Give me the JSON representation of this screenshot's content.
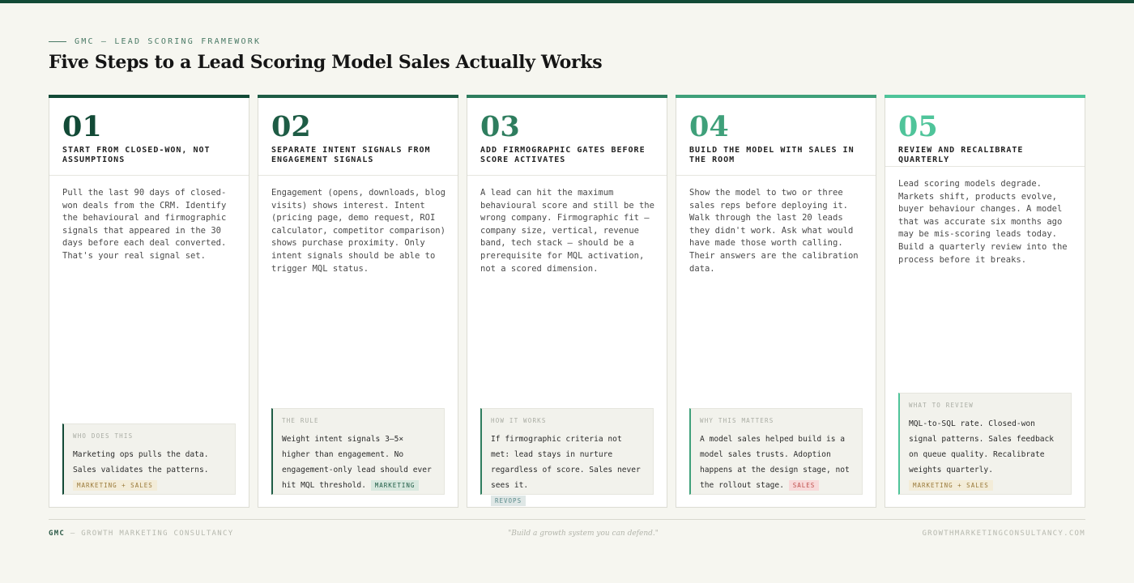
{
  "header": {
    "eyebrow": "GMC — LEAD SCORING FRAMEWORK",
    "title": "Five Steps to a Lead Scoring Model Sales Actually Works"
  },
  "colors": {
    "topbar": "#124a36",
    "step1": "#124a36",
    "step2": "#1e5c45",
    "step3": "#2e7d5e",
    "step4": "#3fa07a",
    "step5": "#4fc49a"
  },
  "steps": [
    {
      "number": "01",
      "title": "START FROM CLOSED-WON, NOT ASSUMPTIONS",
      "body": "Pull the last 90 days of closed-won deals from the CRM. Identify the behavioural and firmographic signals that appeared in the 30 days before each deal converted. That's your real signal set.",
      "note_label": "WHO DOES THIS",
      "note_text": "Marketing ops pulls the data. Sales validates the patterns.",
      "tag": "MARKETING + SALES"
    },
    {
      "number": "02",
      "title": "SEPARATE INTENT SIGNALS FROM ENGAGEMENT SIGNALS",
      "body": "Engagement (opens, downloads, blog visits) shows interest. Intent (pricing page, demo request, ROI calculator, competitor comparison) shows purchase proximity. Only intent signals should be able to trigger MQL status.",
      "note_label": "THE RULE",
      "note_text": "Weight intent signals 3–5× higher than engagement. No engagement-only lead should ever hit MQL threshold.",
      "tag": "MARKETING"
    },
    {
      "number": "03",
      "title": "ADD FIRMOGRAPHIC GATES BEFORE SCORE ACTIVATES",
      "body": "A lead can hit the maximum behavioural score and still be the wrong company. Firmographic fit — company size, vertical, revenue band, tech stack — should be a prerequisite for MQL activation, not a scored dimension.",
      "note_label": "HOW IT WORKS",
      "note_text": "If firmographic criteria not met: lead stays in nurture regardless of score. Sales never sees it.",
      "tag": "REVOPS"
    },
    {
      "number": "04",
      "title": "BUILD THE MODEL WITH SALES IN THE ROOM",
      "body": "Show the model to two or three sales reps before deploying it. Walk through the last 20 leads they didn't work. Ask what would have made those worth calling. Their answers are the calibration data.",
      "note_label": "WHY THIS MATTERS",
      "note_text": "A model sales helped build is a model sales trusts. Adoption happens at the design stage, not the rollout stage.",
      "tag": "SALES"
    },
    {
      "number": "05",
      "title": "REVIEW AND RECALIBRATE QUARTERLY",
      "body": "Lead scoring models degrade. Markets shift, products evolve, buyer behaviour changes. A model that was accurate six months ago may be mis-scoring leads today. Build a quarterly review into the process before it breaks.",
      "note_label": "WHAT TO REVIEW",
      "note_text": "MQL-to-SQL rate. Closed-won signal patterns. Sales feedback on queue quality. Recalibrate weights quarterly.",
      "tag": "MARKETING + SALES"
    }
  ],
  "footer": {
    "brand": "GMC",
    "brand_suffix": " — GROWTH MARKETING CONSULTANCY",
    "quote": "\"Build a growth system you can defend.\"",
    "site": "GROWTHMARKETINGCONSULTANCY.COM"
  }
}
